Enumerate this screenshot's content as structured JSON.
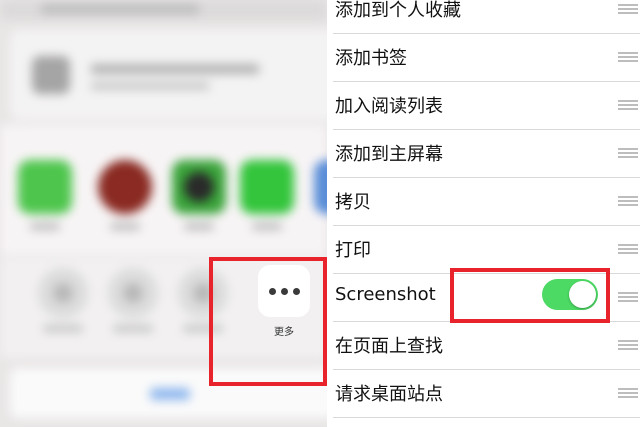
{
  "share_sheet": {
    "more_label": "更多"
  },
  "action_list": {
    "items": [
      {
        "label": "添加到个人收藏"
      },
      {
        "label": "添加书签"
      },
      {
        "label": "加入阅读列表"
      },
      {
        "label": "添加到主屏幕"
      },
      {
        "label": "拷贝"
      },
      {
        "label": "打印"
      },
      {
        "label": "Screenshot",
        "toggle": true,
        "toggle_on": true
      },
      {
        "label": "在页面上查找"
      },
      {
        "label": "请求桌面站点"
      }
    ]
  },
  "colors": {
    "toggle_on": "#4cd964",
    "highlight": "#e8232c"
  },
  "icons": [
    "more-dots-icon",
    "reorder-handle-icon"
  ]
}
